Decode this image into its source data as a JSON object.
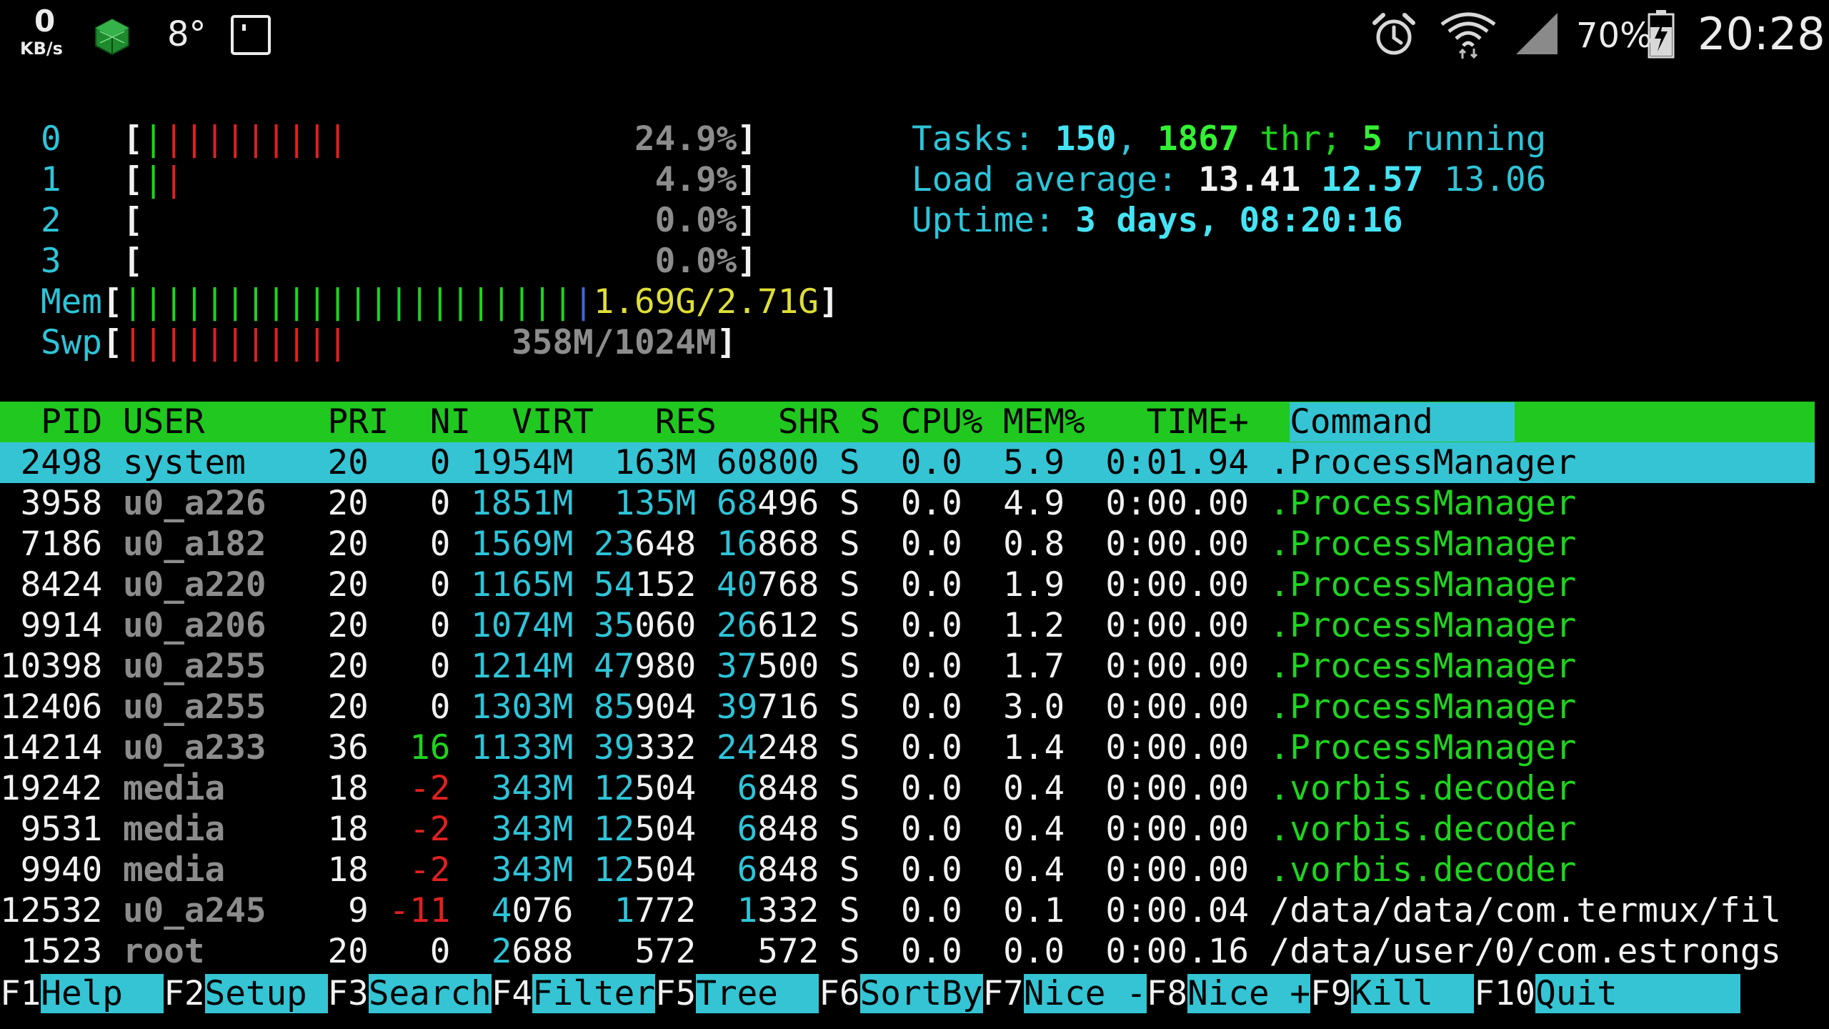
{
  "statusbar": {
    "kbs_value": "0",
    "kbs_unit": "KB/s",
    "temperature": "8°",
    "battery_percent": "70%",
    "clock": "20:28",
    "icons": [
      "cube-icon",
      "screen-icon",
      "alarm-icon",
      "wifi-icon",
      "signal-icon",
      "battery-charging-icon"
    ]
  },
  "meters": {
    "cpus": [
      {
        "label": "0",
        "percent": "24.9%",
        "bars": [
          [
            "green",
            1
          ],
          [
            "red",
            9
          ]
        ]
      },
      {
        "label": "1",
        "percent": "4.9%",
        "bars": [
          [
            "green",
            1
          ],
          [
            "red",
            1
          ]
        ]
      },
      {
        "label": "2",
        "percent": "0.0%",
        "bars": []
      },
      {
        "label": "3",
        "percent": "0.0%",
        "bars": []
      }
    ],
    "mem": {
      "label": "Mem",
      "value": "1.69G/2.71G",
      "bars": [
        [
          "green",
          22
        ],
        [
          "blue",
          1
        ]
      ]
    },
    "swp": {
      "label": "Swp",
      "value": "358M/1024M",
      "bars": [
        [
          "red",
          11
        ]
      ]
    }
  },
  "summary": {
    "tasks_label": "Tasks: ",
    "tasks": "150",
    "threads": "1867",
    "thr_label": " thr; ",
    "running": "5",
    "running_label": " running",
    "load_label": "Load average: ",
    "load1": "13.41",
    "load5": "12.57",
    "load15": "13.06",
    "uptime_label": "Uptime: ",
    "uptime": "3 days, 08:20:16"
  },
  "table": {
    "header": {
      "columns": "  PID USER      PRI  NI  VIRT   RES   SHR S CPU% MEM%   TIME+  ",
      "command": "Command    "
    },
    "rows": [
      {
        "pid": "2498",
        "user": "system",
        "pri": "20",
        "ni": "0",
        "virt": "1954M",
        "res": "163M",
        "shr": "60800",
        "s": "S",
        "cpu": "0.0",
        "mem": "5.9",
        "time": "0:01.94",
        "command": ".ProcessManager",
        "selected": true
      },
      {
        "pid": "3958",
        "user": "u0_a226",
        "pri": "20",
        "ni": "0",
        "virt": "1851M",
        "res": "135M",
        "shr": "68496",
        "s": "S",
        "cpu": "0.0",
        "mem": "4.9",
        "time": "0:00.00",
        "command": ".ProcessManager"
      },
      {
        "pid": "7186",
        "user": "u0_a182",
        "pri": "20",
        "ni": "0",
        "virt": "1569M",
        "res": "23648",
        "shr": "16868",
        "s": "S",
        "cpu": "0.0",
        "mem": "0.8",
        "time": "0:00.00",
        "command": ".ProcessManager"
      },
      {
        "pid": "8424",
        "user": "u0_a220",
        "pri": "20",
        "ni": "0",
        "virt": "1165M",
        "res": "54152",
        "shr": "40768",
        "s": "S",
        "cpu": "0.0",
        "mem": "1.9",
        "time": "0:00.00",
        "command": ".ProcessManager"
      },
      {
        "pid": "9914",
        "user": "u0_a206",
        "pri": "20",
        "ni": "0",
        "virt": "1074M",
        "res": "35060",
        "shr": "26612",
        "s": "S",
        "cpu": "0.0",
        "mem": "1.2",
        "time": "0:00.00",
        "command": ".ProcessManager"
      },
      {
        "pid": "10398",
        "user": "u0_a255",
        "pri": "20",
        "ni": "0",
        "virt": "1214M",
        "res": "47980",
        "shr": "37500",
        "s": "S",
        "cpu": "0.0",
        "mem": "1.7",
        "time": "0:00.00",
        "command": ".ProcessManager"
      },
      {
        "pid": "12406",
        "user": "u0_a255",
        "pri": "20",
        "ni": "0",
        "virt": "1303M",
        "res": "85904",
        "shr": "39716",
        "s": "S",
        "cpu": "0.0",
        "mem": "3.0",
        "time": "0:00.00",
        "command": ".ProcessManager"
      },
      {
        "pid": "14214",
        "user": "u0_a233",
        "pri": "36",
        "ni": "16",
        "virt": "1133M",
        "res": "39332",
        "shr": "24248",
        "s": "S",
        "cpu": "0.0",
        "mem": "1.4",
        "time": "0:00.00",
        "command": ".ProcessManager"
      },
      {
        "pid": "19242",
        "user": "media",
        "pri": "18",
        "ni": "-2",
        "virt": "343M",
        "res": "12504",
        "shr": "6848",
        "s": "S",
        "cpu": "0.0",
        "mem": "0.4",
        "time": "0:00.00",
        "command": ".vorbis.decoder"
      },
      {
        "pid": "9531",
        "user": "media",
        "pri": "18",
        "ni": "-2",
        "virt": "343M",
        "res": "12504",
        "shr": "6848",
        "s": "S",
        "cpu": "0.0",
        "mem": "0.4",
        "time": "0:00.00",
        "command": ".vorbis.decoder"
      },
      {
        "pid": "9940",
        "user": "media",
        "pri": "18",
        "ni": "-2",
        "virt": "343M",
        "res": "12504",
        "shr": "6848",
        "s": "S",
        "cpu": "0.0",
        "mem": "0.4",
        "time": "0:00.00",
        "command": ".vorbis.decoder"
      },
      {
        "pid": "12532",
        "user": "u0_a245",
        "pri": "9",
        "ni": "-11",
        "virt": "4076",
        "res": "1772",
        "shr": "1332",
        "s": "S",
        "cpu": "0.0",
        "mem": "0.1",
        "time": "0:00.04",
        "command": "/data/data/com.termux/fil"
      },
      {
        "pid": "1523",
        "user": "root",
        "pri": "20",
        "ni": "0",
        "virt": "2688",
        "res": "572",
        "shr": "572",
        "s": "S",
        "cpu": "0.0",
        "mem": "0.0",
        "time": "0:00.16",
        "command": "/data/user/0/com.estrongs"
      }
    ]
  },
  "footer": [
    {
      "key": "F1",
      "label": "Help  "
    },
    {
      "key": "F2",
      "label": "Setup "
    },
    {
      "key": "F3",
      "label": "Search"
    },
    {
      "key": "F4",
      "label": "Filter"
    },
    {
      "key": "F5",
      "label": "Tree  "
    },
    {
      "key": "F6",
      "label": "SortBy"
    },
    {
      "key": "F7",
      "label": "Nice -"
    },
    {
      "key": "F8",
      "label": "Nice +"
    },
    {
      "key": "F9",
      "label": "Kill  "
    },
    {
      "key": "F10",
      "label": "Quit      "
    }
  ],
  "colors": {
    "header_bg": "#20c820",
    "highlight_bg": "#34c4d4",
    "cyan": "#2ec4d8",
    "green": "#1ed41e",
    "red": "#e02020"
  }
}
